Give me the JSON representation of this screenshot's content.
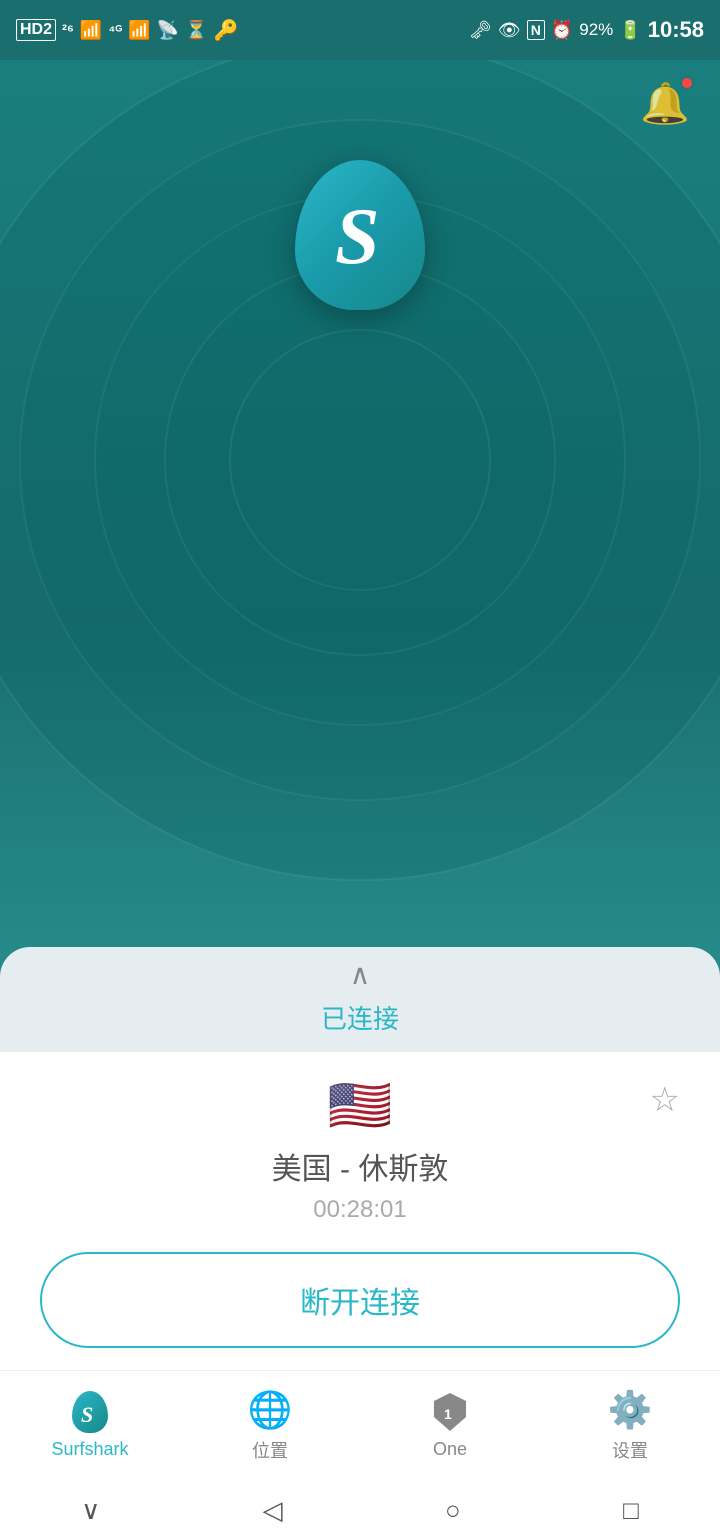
{
  "statusBar": {
    "time": "10:58",
    "battery": "92%",
    "leftIcons": [
      "HD2",
      "26",
      "4G",
      "wifi",
      "hourglass",
      "vpn"
    ],
    "rightIcons": [
      "key",
      "eye",
      "nfc",
      "alarm",
      "battery"
    ]
  },
  "notification": {
    "hasDot": true
  },
  "logo": {
    "letter": "S"
  },
  "connectionPanel": {
    "chevronLabel": "^",
    "connectedText": "已连接",
    "flagEmoji": "🇺🇸",
    "locationName": "美国 - 休斯敦",
    "timer": "00:28:01",
    "disconnectLabel": "断开连接"
  },
  "bottomNav": {
    "items": [
      {
        "id": "surfshark",
        "label": "Surfshark",
        "active": true
      },
      {
        "id": "location",
        "label": "位置",
        "active": false
      },
      {
        "id": "one",
        "label": "One",
        "active": false
      },
      {
        "id": "settings",
        "label": "设置",
        "active": false
      }
    ]
  },
  "sysNav": {
    "back": "‹",
    "home": "○",
    "recent": "□"
  }
}
